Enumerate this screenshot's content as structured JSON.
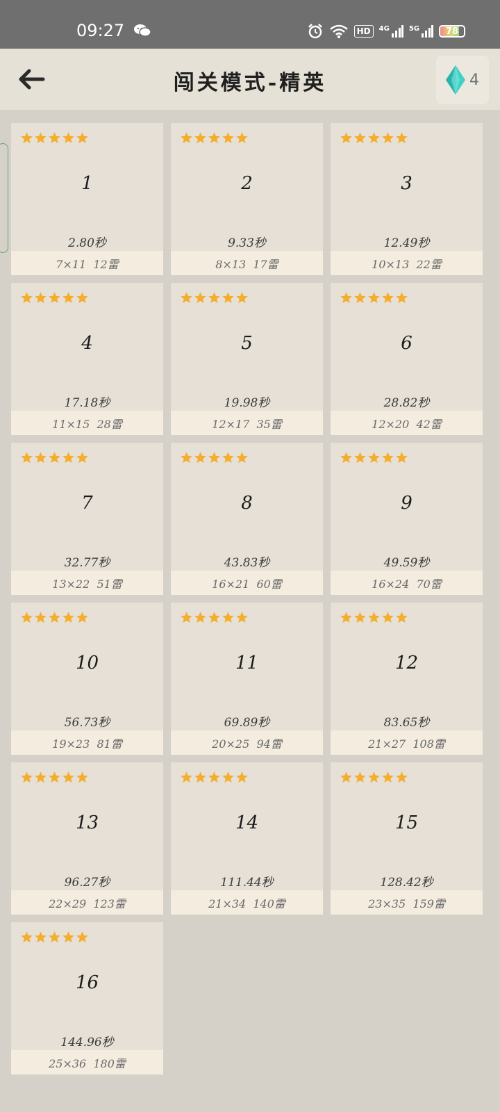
{
  "status_bar": {
    "time": "09:27",
    "battery": "78",
    "battery_level": 0.78,
    "network_1": "4G",
    "network_2": "5G",
    "hd_badge": "HD"
  },
  "header": {
    "title": "闯关模式-精英",
    "gem_count": "4"
  },
  "colors": {
    "star": "#f4ad2c",
    "gem": "#3fd0c6"
  },
  "levels": [
    {
      "num": "1",
      "time": "2.80秒",
      "info": "7×11  12雷",
      "stars": 5
    },
    {
      "num": "2",
      "time": "9.33秒",
      "info": "8×13  17雷",
      "stars": 5
    },
    {
      "num": "3",
      "time": "12.49秒",
      "info": "10×13  22雷",
      "stars": 5
    },
    {
      "num": "4",
      "time": "17.18秒",
      "info": "11×15  28雷",
      "stars": 5
    },
    {
      "num": "5",
      "time": "19.98秒",
      "info": "12×17  35雷",
      "stars": 5
    },
    {
      "num": "6",
      "time": "28.82秒",
      "info": "12×20  42雷",
      "stars": 5
    },
    {
      "num": "7",
      "time": "32.77秒",
      "info": "13×22  51雷",
      "stars": 5
    },
    {
      "num": "8",
      "time": "43.83秒",
      "info": "16×21  60雷",
      "stars": 5
    },
    {
      "num": "9",
      "time": "49.59秒",
      "info": "16×24  70雷",
      "stars": 5
    },
    {
      "num": "10",
      "time": "56.73秒",
      "info": "19×23  81雷",
      "stars": 5
    },
    {
      "num": "11",
      "time": "69.89秒",
      "info": "20×25  94雷",
      "stars": 5
    },
    {
      "num": "12",
      "time": "83.65秒",
      "info": "21×27  108雷",
      "stars": 5
    },
    {
      "num": "13",
      "time": "96.27秒",
      "info": "22×29  123雷",
      "stars": 5
    },
    {
      "num": "14",
      "time": "111.44秒",
      "info": "21×34  140雷",
      "stars": 5
    },
    {
      "num": "15",
      "time": "128.42秒",
      "info": "23×35  159雷",
      "stars": 5
    },
    {
      "num": "16",
      "time": "144.96秒",
      "info": "25×36  180雷",
      "stars": 5
    }
  ]
}
